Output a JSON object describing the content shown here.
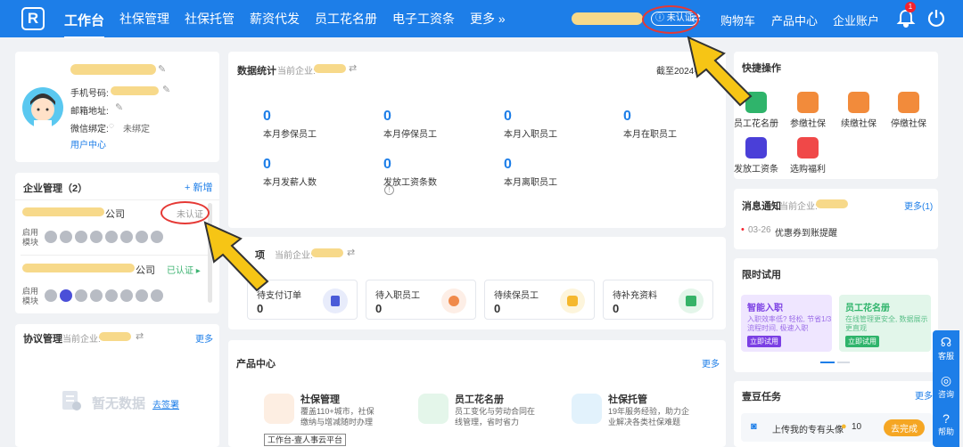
{
  "topbar": {
    "logo": "R",
    "nav": [
      "工作台",
      "社保管理",
      "社保托管",
      "薪资代发",
      "员工花名册",
      "电子工资条",
      "更多 »"
    ],
    "cert_status": "未认证",
    "swap": "⇄",
    "links": [
      "购物车",
      "产品中心",
      "企业账户"
    ],
    "bell_count": "1"
  },
  "profile": {
    "phone_label": "手机号码:",
    "email_label": "邮箱地址:",
    "wechat_label": "微信绑定:",
    "wechat_value": "未绑定",
    "user_center": "用户中心"
  },
  "enterprise": {
    "title": "企业管理（2）",
    "add": "+ 新增",
    "items": [
      {
        "suffix": "公司",
        "status": "未认证"
      },
      {
        "suffix": "公司",
        "status": "已认证 ▸"
      }
    ],
    "modules_label": "启用模块"
  },
  "agreement": {
    "title": "协议管理",
    "current": "当前企业:",
    "more": "更多",
    "empty": "暂无数据",
    "go_sign": "去签署"
  },
  "stats": {
    "title": "数据统计",
    "current": "当前企业:",
    "cutoff": "截至2024-",
    "items": [
      {
        "num": "0",
        "label": "本月参保员工"
      },
      {
        "num": "0",
        "label": "本月停保员工"
      },
      {
        "num": "0",
        "label": "本月入职员工"
      },
      {
        "num": "0",
        "label": "本月在职员工"
      },
      {
        "num": "0",
        "label": "本月发薪人数"
      },
      {
        "num": "0",
        "label": "发放工资条数"
      },
      {
        "num": "0",
        "label": "本月离职员工"
      }
    ]
  },
  "todo": {
    "title": "项",
    "current": "当前企业:",
    "items": [
      {
        "label": "待支付订单",
        "num": "0"
      },
      {
        "label": "待入职员工",
        "num": "0"
      },
      {
        "label": "待续保员工",
        "num": "0"
      },
      {
        "label": "待补充资料",
        "num": "0"
      }
    ]
  },
  "products": {
    "title": "产品中心",
    "more": "更多",
    "items": [
      {
        "name": "社保管理",
        "desc1": "覆盖110+城市，社保",
        "desc2": "缴纳与增减随时办理"
      },
      {
        "name": "员工花名册",
        "desc1": "员工变化与劳动合同在",
        "desc2": "线管理，省时省力"
      },
      {
        "name": "社保托管",
        "desc1": "19年服务经验，助力企",
        "desc2": "业解决各类社保难题"
      }
    ],
    "tooltip": "工作台-壹人事云平台"
  },
  "quick": {
    "title": "快捷操作",
    "items": [
      "员工花名册",
      "参缴社保",
      "续缴社保",
      "停缴社保",
      "发放工资条",
      "选购福利"
    ]
  },
  "notice": {
    "title": "消息通知",
    "current": "当前企业:",
    "more": "更多(1)",
    "date": "03-26",
    "text": "优惠券到账提醒"
  },
  "trial": {
    "title": "限时试用",
    "cards": [
      {
        "name": "智能入职",
        "desc1": "入职效率低? 轻松, 节省1/3",
        "desc2": "流程时间, 极速入职",
        "btn": "立即试用"
      },
      {
        "name": "员工花名册",
        "desc1": "在线管理更安全, 数据展示",
        "desc2": "更直观",
        "btn": "立即试用"
      }
    ]
  },
  "tasks": {
    "title": "壹豆任务",
    "more": "更多",
    "task": "上传我的专有头像",
    "reward": "10",
    "btn": "去完成"
  },
  "side": [
    "客服",
    "咨询",
    "帮助"
  ],
  "colors": {
    "primary": "#1d7ee8",
    "highlight": "#e53935",
    "arrow": "#f6c515"
  }
}
